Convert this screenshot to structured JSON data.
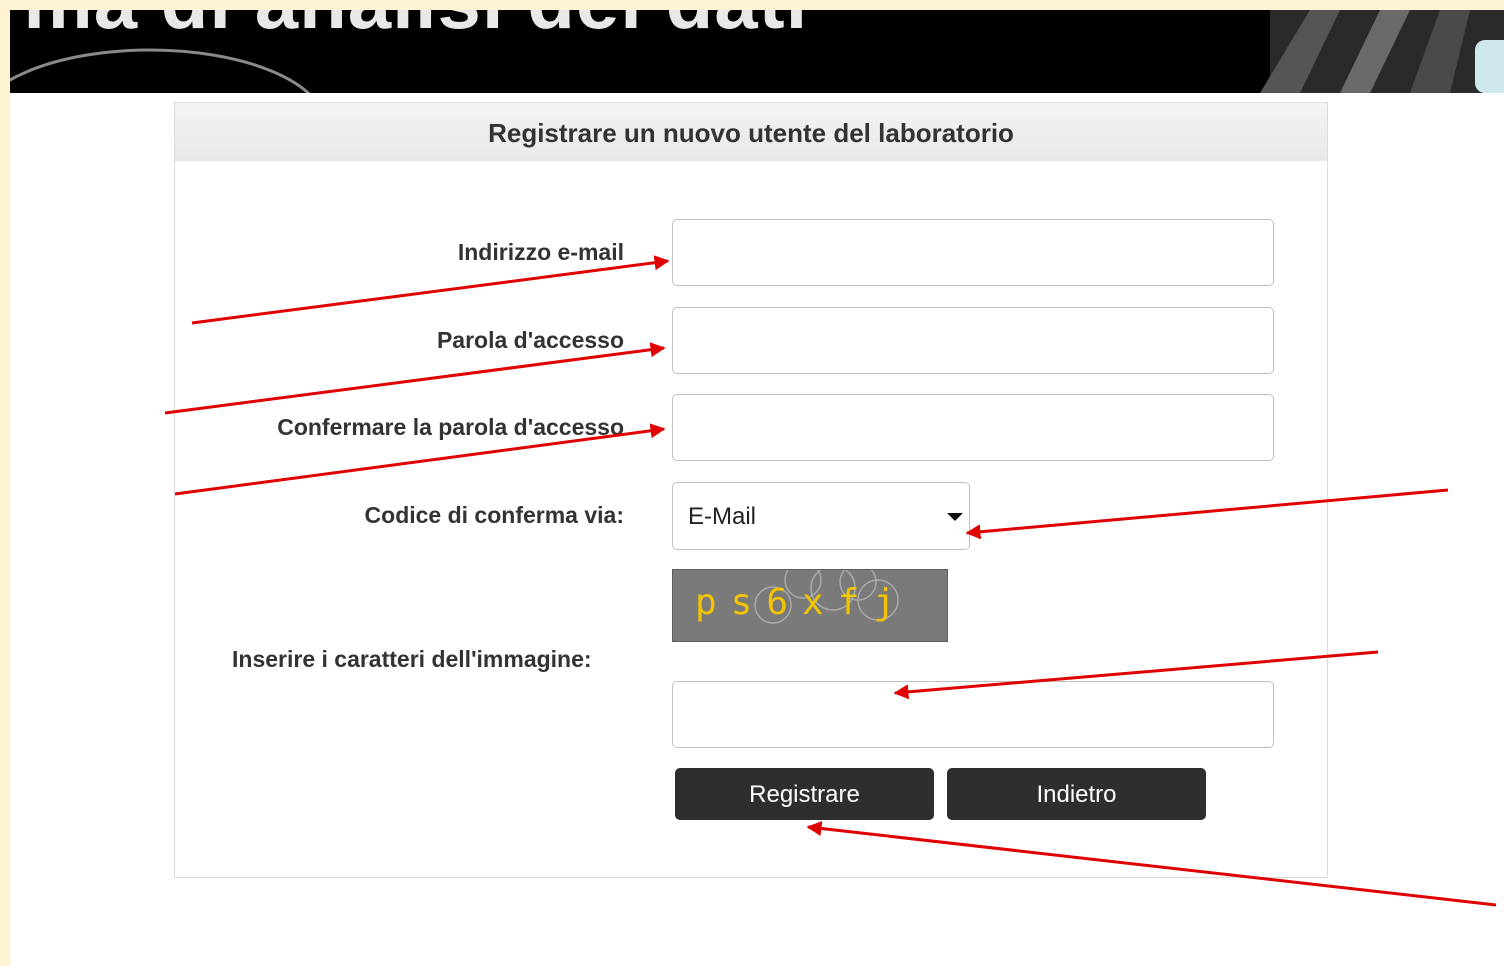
{
  "banner": {
    "title": "rma di analisi dei dati"
  },
  "panel": {
    "title": "Registrare un nuovo utente del laboratorio"
  },
  "form": {
    "email_label": "Indirizzo e-mail",
    "password_label": "Parola d'accesso",
    "confirm_password_label": "Confermare la parola d'accesso",
    "delivery_label": "Codice di conferma via:",
    "delivery_selected": "E-Mail",
    "captcha_label": "Inserire i caratteri dell'immagine:",
    "captcha_text": "ps6xfj",
    "email_value": "",
    "password_value": "",
    "confirm_password_value": "",
    "captcha_value": ""
  },
  "buttons": {
    "register": "Registrare",
    "back": "Indietro"
  },
  "colors": {
    "annotation_arrow": "#e00000",
    "button": "#2e2e2e",
    "captcha_text": "#f2c300"
  }
}
